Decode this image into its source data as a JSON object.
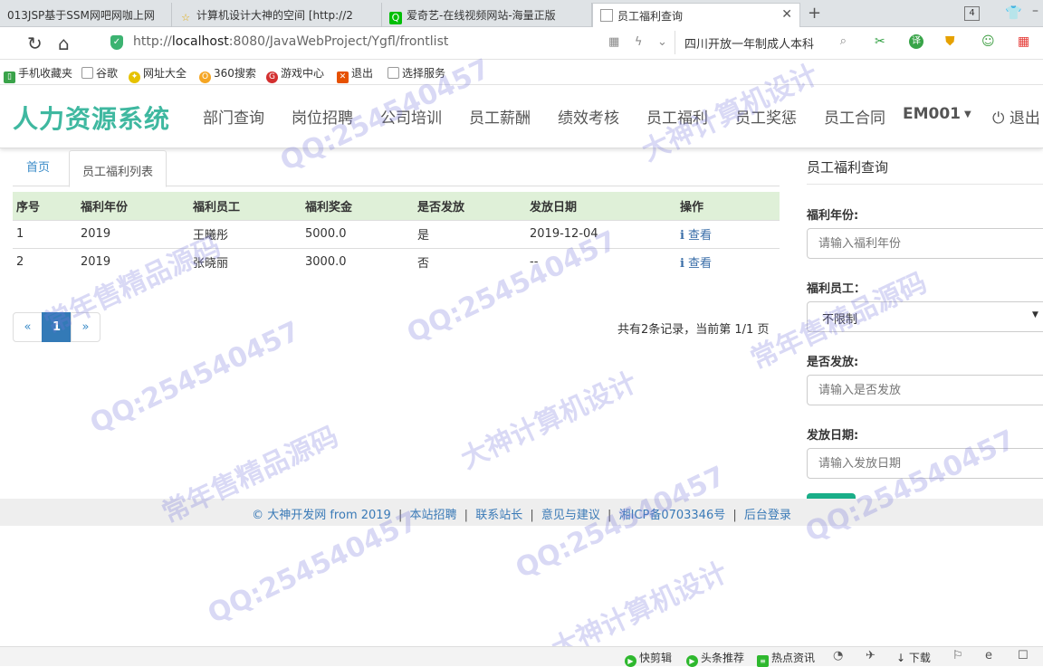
{
  "browser": {
    "tabs": [
      {
        "label": "013JSP基于SSM网吧网咖上网"
      },
      {
        "label": "计算机设计大神的空间 [http://2"
      },
      {
        "label": "爱奇艺-在线视频网站-海量正版"
      },
      {
        "label": "员工福利查询"
      }
    ],
    "tab_count": "4",
    "url_prefix": "http://",
    "url_host": "localhost",
    "url_path": ":8080/JavaWebProject/Ygfl/frontlist",
    "search_text": "四川开放一年制成人本科",
    "bookmarks": [
      "手机收藏夹",
      "谷歌",
      "网址大全",
      "360搜索",
      "游戏中心",
      "退出",
      "选择服务"
    ]
  },
  "site": {
    "logo": "人力资源系统",
    "nav": [
      "部门查询",
      "岗位招聘",
      "公司培训",
      "员工薪酬",
      "绩效考核",
      "员工福利",
      "员工奖惩",
      "员工合同"
    ],
    "user": "EM001",
    "logout": "退出"
  },
  "breadcrumb": {
    "home": "首页",
    "current": "员工福利列表"
  },
  "table": {
    "headers": [
      "序号",
      "福利年份",
      "福利员工",
      "福利奖金",
      "是否发放",
      "发放日期",
      "操作"
    ],
    "rows": [
      {
        "no": "1",
        "year": "2019",
        "employee": "王曦彤",
        "bonus": "5000.0",
        "issued": "是",
        "date": "2019-12-04",
        "action": "查看"
      },
      {
        "no": "2",
        "year": "2019",
        "employee": "张晓丽",
        "bonus": "3000.0",
        "issued": "否",
        "date": "--",
        "action": "查看"
      }
    ]
  },
  "pager": {
    "prev": "«",
    "current": "1",
    "next": "»",
    "info": "共有2条记录，当前第 1/1 页"
  },
  "search_panel": {
    "title": "员工福利查询",
    "year_label": "福利年份:",
    "year_placeholder": "请输入福利年份",
    "employee_label": "福利员工：",
    "employee_value": "不限制",
    "issued_label": "是否发放:",
    "issued_placeholder": "请输入是否发放",
    "date_label": "发放日期:",
    "date_placeholder": "请输入发放日期",
    "query_button": "查询"
  },
  "footer": {
    "copyright": "© 大神开发网 from 2019",
    "links": [
      "本站招聘",
      "联系站长",
      "意见与建议",
      "湘ICP备0703346号",
      "后台登录"
    ]
  },
  "statusbar": {
    "items": [
      "快剪辑",
      "头条推荐",
      "热点资讯",
      "下载"
    ]
  },
  "watermark": [
    "QQ:254540457",
    "大神计算机设计",
    "常年售精品源码"
  ],
  "colors": {
    "logo": "#3fb8a0",
    "table_header": "#dff0d8",
    "pager_active": "#337ab7",
    "query_button": "#1aae88",
    "link": "#3a8bc8"
  }
}
